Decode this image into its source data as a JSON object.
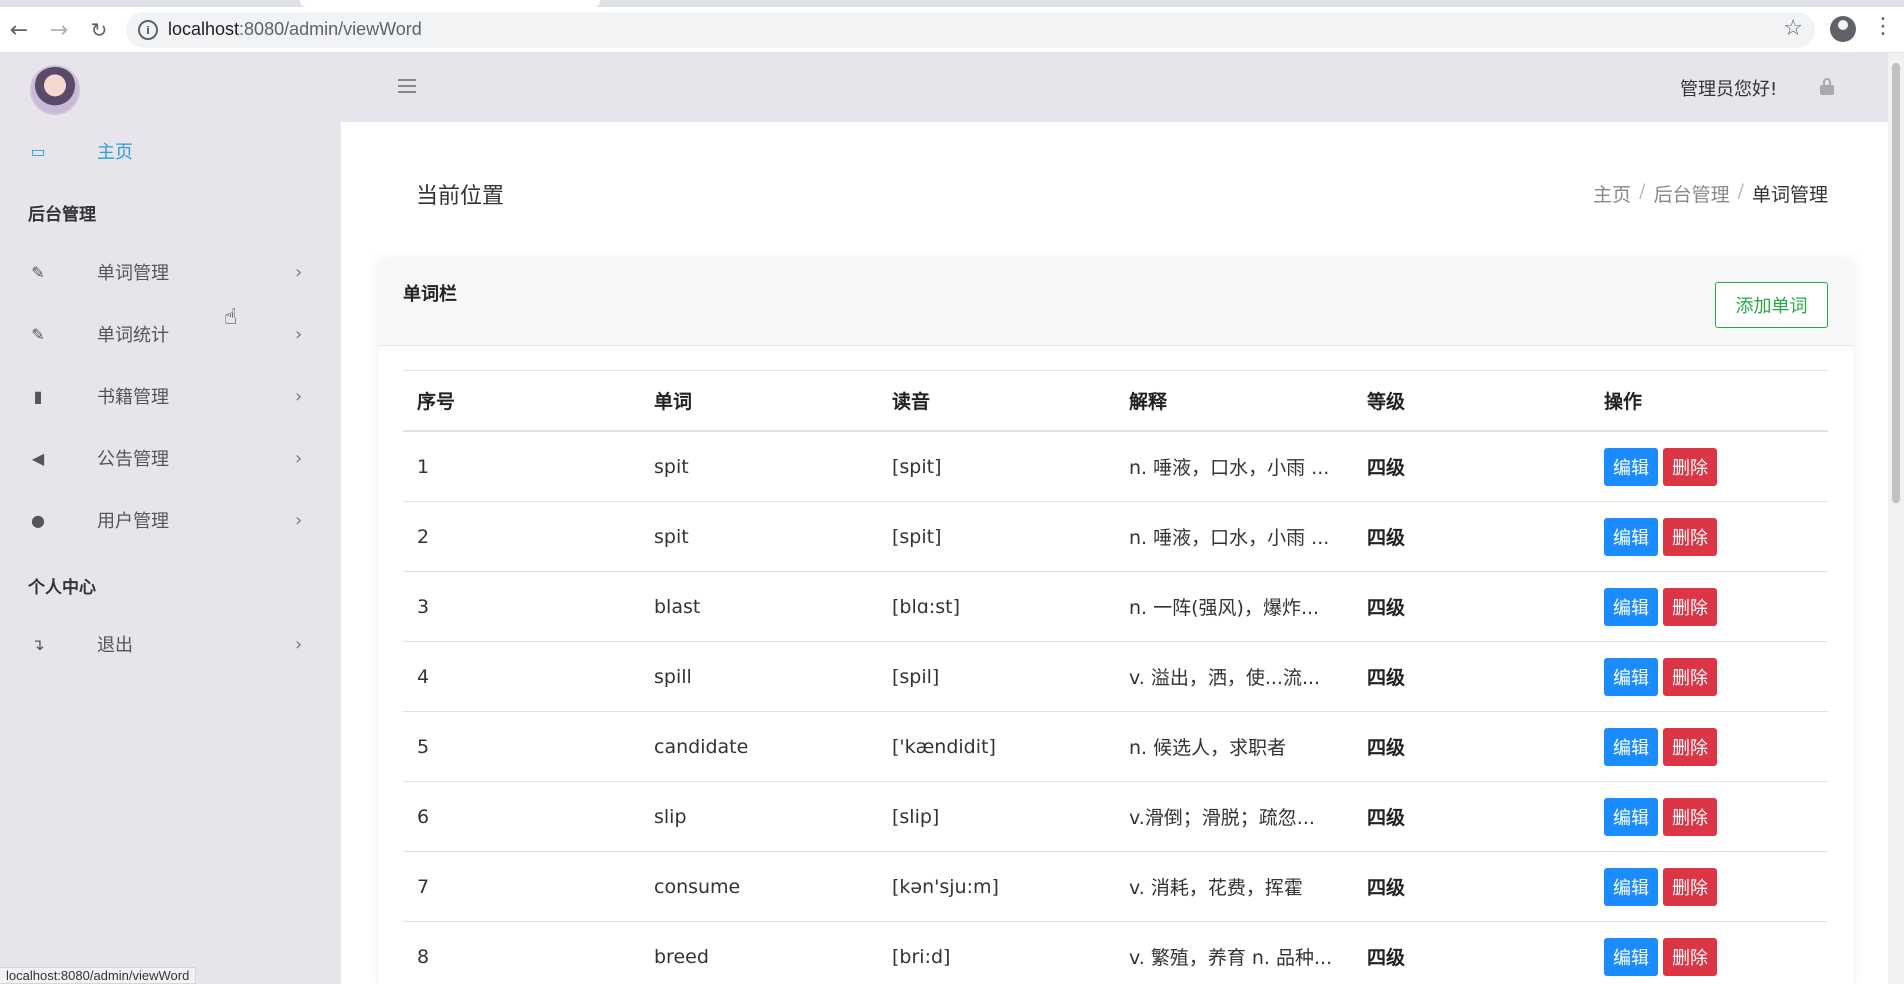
{
  "browser": {
    "url_host": "localhost",
    "url_path": ":8080/admin/viewWord",
    "status_url": "localhost:8080/admin/viewWord"
  },
  "sidebar": {
    "home": "主页",
    "section_admin": "后台管理",
    "items": [
      {
        "label": "单词管理",
        "icon": "edit-icon"
      },
      {
        "label": "单词统计",
        "icon": "edit-icon"
      },
      {
        "label": "书籍管理",
        "icon": "book-icon"
      },
      {
        "label": "公告管理",
        "icon": "volume-icon"
      },
      {
        "label": "用户管理",
        "icon": "user-icon"
      }
    ],
    "section_personal": "个人中心",
    "logout": "退出"
  },
  "header": {
    "greeting": "管理员您好!"
  },
  "page": {
    "position_label": "当前位置",
    "breadcrumb": [
      "主页",
      "后台管理",
      "单词管理"
    ],
    "card_title": "单词栏",
    "add_button": "添加单词"
  },
  "table": {
    "headers": [
      "序号",
      "单词",
      "读音",
      "解释",
      "等级",
      "操作"
    ],
    "edit_label": "编辑",
    "delete_label": "删除",
    "rows": [
      {
        "no": "1",
        "word": "spit",
        "phonetic": "[spit]",
        "meaning": "n. 唾液，口水，小雨 ...",
        "level": "四级"
      },
      {
        "no": "2",
        "word": "spit",
        "phonetic": "[spit]",
        "meaning": "n. 唾液，口水，小雨 ...",
        "level": "四级"
      },
      {
        "no": "3",
        "word": "blast",
        "phonetic": "[blɑ:st]",
        "meaning": "n. 一阵(强风)，爆炸...",
        "level": "四级"
      },
      {
        "no": "4",
        "word": "spill",
        "phonetic": "[spil]",
        "meaning": "v. 溢出，洒，使...流...",
        "level": "四级"
      },
      {
        "no": "5",
        "word": "candidate",
        "phonetic": "['kændidit]",
        "meaning": "n. 候选人，求职者",
        "level": "四级"
      },
      {
        "no": "6",
        "word": "slip",
        "phonetic": "[slip]",
        "meaning": "v.滑倒；滑脱；疏忽...",
        "level": "四级"
      },
      {
        "no": "7",
        "word": "consume",
        "phonetic": "[kən'sju:m]",
        "meaning": "v. 消耗，花费，挥霍",
        "level": "四级"
      },
      {
        "no": "8",
        "word": "breed",
        "phonetic": "[bri:d]",
        "meaning": "v. 繁殖，养育 n. 品种...",
        "level": "四级"
      }
    ]
  },
  "colors": {
    "accent": "#2b9fd9",
    "sidebar_bg": "#e8e4ec",
    "edit_btn": "#1a8cff",
    "delete_btn": "#dc3545",
    "add_btn": "#28a745"
  }
}
